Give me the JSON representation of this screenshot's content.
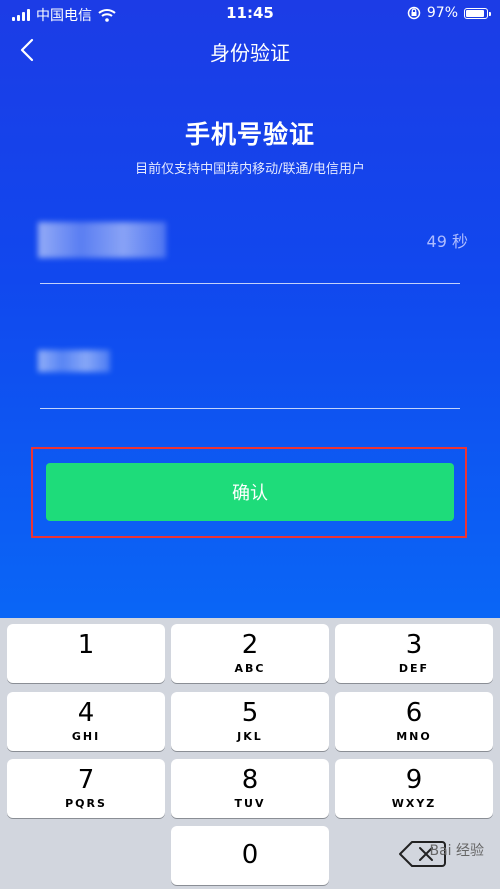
{
  "status_bar": {
    "carrier": "中国电信",
    "time": "11:45",
    "battery_percent": "97%",
    "battery_level": 0.97,
    "icons": [
      "signal-icon",
      "wifi-icon",
      "orientation-lock-icon",
      "battery-icon"
    ]
  },
  "nav": {
    "title": "身份验证",
    "back_icon": "chevron-left-icon"
  },
  "main": {
    "heading": "手机号验证",
    "subtitle": "目前仅支持中国境内移动/联通/电信用户",
    "countdown": "49 秒",
    "confirm_label": "确认",
    "accent_color": "#1edc7a"
  },
  "keyboard": {
    "keys": [
      {
        "num": "1",
        "letters": ""
      },
      {
        "num": "2",
        "letters": "ABC"
      },
      {
        "num": "3",
        "letters": "DEF"
      },
      {
        "num": "4",
        "letters": "GHI"
      },
      {
        "num": "5",
        "letters": "JKL"
      },
      {
        "num": "6",
        "letters": "MNO"
      },
      {
        "num": "7",
        "letters": "PQRS"
      },
      {
        "num": "8",
        "letters": "TUV"
      },
      {
        "num": "9",
        "letters": "WXYZ"
      },
      {
        "num": "0",
        "letters": ""
      }
    ],
    "delete_icon": "backspace-icon"
  },
  "watermark": "Bai 经验"
}
